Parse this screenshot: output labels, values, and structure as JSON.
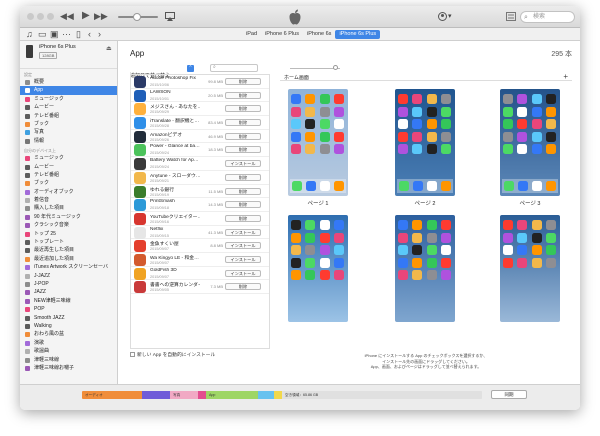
{
  "toolbar": {
    "prev": "◀◀",
    "play": "▶",
    "next": "▶▶",
    "account": "▾",
    "search_placeholder": "検索"
  },
  "subbar": {
    "device_tabs": [
      "iPad",
      "iPhone 6 Plus",
      "iPhone 6s",
      "iPhone 6s Plus"
    ],
    "active_tab": "iPhone 6s Plus"
  },
  "sidebar": {
    "device_name": "iPhone 6s Plus",
    "capacity": "128GB",
    "settings_header": "設定",
    "settings_items": [
      "概要",
      "App",
      "ミュージック",
      "ムービー",
      "テレビ番組",
      "ブック",
      "写真",
      "情報"
    ],
    "ondevice_header": "自分のデバイス上",
    "ondevice_items": [
      "ミュージック",
      "ムービー",
      "テレビ番組",
      "ブック",
      "オーディオブック",
      "着信音",
      "購入した項目",
      "90 年代ミュージック",
      "クラシック音楽",
      "トップ 25",
      "トップレート",
      "最近再生した項目",
      "最近追加した項目",
      "iTunes Artwork スクリーンセーバ",
      "J-JAZZ",
      "J-POP",
      "JAZZ",
      "NEW津軽三味線",
      "POP",
      "Smooth JAZZ",
      "Walking",
      "おわら風の盆",
      "演歌",
      "歌謡曲",
      "津軽三味線",
      "津軽三味線お囃子"
    ]
  },
  "main": {
    "title": "App",
    "count": "295 本",
    "sort_label": "追加日で並べ替え",
    "sort_arrow": "⌃",
    "apps": [
      {
        "name": "Adobe Photoshop Fix",
        "date": "2015/10/06",
        "size": "99.8 MB",
        "button": "削除",
        "color": "#2b3a67"
      },
      {
        "name": "LAWSON",
        "date": "2015/10/01",
        "size": "20.5 MB",
        "button": "削除",
        "color": "#1f5fb8"
      },
      {
        "name": "メジスさん - あなたを…",
        "date": "2015/09/29",
        "size": "",
        "button": "削除",
        "color": "#ffb13d"
      },
      {
        "name": "iTranslate - 翻訳機と…",
        "date": "2015/09/28",
        "size": "83.4 MB",
        "button": "削除",
        "color": "#2f8fe8"
      },
      {
        "name": "Amazonビデオ",
        "date": "2015/09/26",
        "size": "46.9 MB",
        "button": "削除",
        "color": "#222d3b"
      },
      {
        "name": "Power - Glance at ba…",
        "date": "2015/09/24",
        "size": "18.3 MB",
        "button": "削除",
        "color": "#4cc35b"
      },
      {
        "name": "Battery Watch for Ap…",
        "date": "2015/09/24",
        "size": "",
        "button": "インストール",
        "color": "#3a3a3a"
      },
      {
        "name": "Anytune - スローダウ…",
        "date": "2015/09/21",
        "size": "",
        "button": "削除",
        "color": "#f2b84b"
      },
      {
        "name": "ゆれる銀行",
        "date": "2015/09/19",
        "size": "11.5 MB",
        "button": "削除",
        "color": "#3a7d2c"
      },
      {
        "name": "PrintSmash",
        "date": "2015/09/18",
        "size": "14.3 MB",
        "button": "削除",
        "color": "#2d9ad8"
      },
      {
        "name": "YouTubeクリエイター…",
        "date": "2015/09/16",
        "size": "",
        "button": "削除",
        "color": "#d7362f"
      },
      {
        "name": "Netflix",
        "date": "2015/09/15",
        "size": "41.3 MB",
        "button": "インストール",
        "color": "#e6e6e6"
      },
      {
        "name": "金魚すくい屋",
        "date": "2015/09/07",
        "size": "8.8 MB",
        "button": "インストール",
        "color": "#e43f2d"
      },
      {
        "name": "Wa Kingyo LE - 和金…",
        "date": "2015/09/07",
        "size": "",
        "button": "インストール",
        "color": "#d35a2d"
      },
      {
        "name": "GoldFish 3D",
        "date": "2015/09/07",
        "size": "",
        "button": "インストール",
        "color": "#f0a323"
      },
      {
        "name": "書書への逆算カレンダー",
        "date": "2015/09/05",
        "size": "7.3 MB",
        "button": "削除",
        "color": "#c93a3a"
      }
    ],
    "auto_install": "新しい App を自動的にインストール",
    "home_label": "ホーム画面",
    "home_plus": "+",
    "pages": [
      "ページ 1",
      "ページ 2",
      "ページ 3"
    ],
    "footer_line1": "iPhone にインストールする App のチェックボックスを選択するか、",
    "footer_line2": "インストール先の画面にドラッグしてください。",
    "footer_line3": "App、画面、およびページはドラッグして並べ替えられます。"
  },
  "capacity_bar": {
    "segments": [
      {
        "label": "オーディオ",
        "fraction": 0.15,
        "color": "#f08d3a"
      },
      {
        "label": "",
        "fraction": 0.07,
        "color": "#6f5bd8"
      },
      {
        "label": "写真",
        "fraction": 0.07,
        "color": "#f1a9c4"
      },
      {
        "label": "",
        "fraction": 0.02,
        "color": "#e34e8f"
      },
      {
        "label": "App",
        "fraction": 0.13,
        "color": "#9ed665"
      },
      {
        "label": "",
        "fraction": 0.04,
        "color": "#67c2ef"
      },
      {
        "label": "",
        "fraction": 0.02,
        "color": "#f2d84b"
      },
      {
        "label": "空き領域：65.86 GB",
        "fraction": 0.5,
        "color": "#e0e0e0"
      }
    ],
    "sync_label": "同期"
  }
}
